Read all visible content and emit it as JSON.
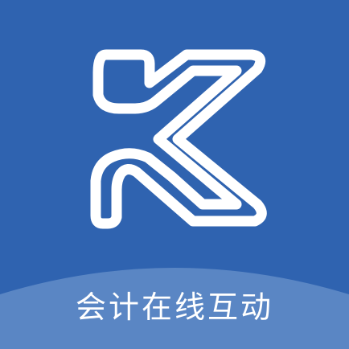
{
  "app": {
    "caption": "会计在线互动",
    "logo": {
      "icon": "letter-k-logo-icon"
    },
    "colors": {
      "background": "#2f63b0",
      "band": "#5a86c4",
      "logo_stroke": "#ffffff",
      "caption": "#ffffff"
    }
  }
}
